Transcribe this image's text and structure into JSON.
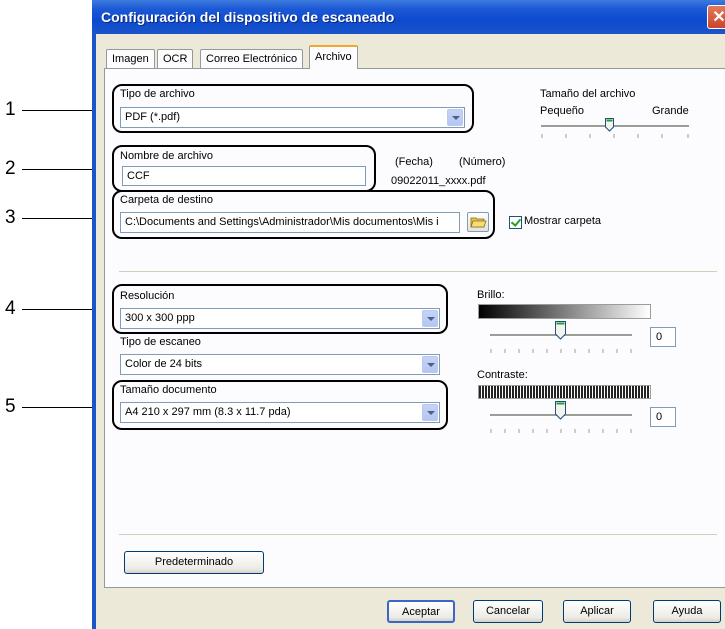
{
  "window": {
    "title": "Configuración del dispositivo de escaneado",
    "close_symbol": "✕"
  },
  "tabs": [
    {
      "label": "Imagen"
    },
    {
      "label": "OCR"
    },
    {
      "label": "Correo Electrónico"
    },
    {
      "label": "Archivo",
      "active": true
    }
  ],
  "callouts": [
    "1",
    "2",
    "3",
    "4",
    "5"
  ],
  "file_type": {
    "label": "Tipo de archivo",
    "value": "PDF (*.pdf)"
  },
  "file_size": {
    "label": "Tamaño del archivo",
    "small": "Pequeño",
    "large": "Grande",
    "level_fraction": 0.53
  },
  "file_name": {
    "label": "Nombre de archivo",
    "value": "CCF",
    "date_hint": "(Fecha)",
    "number_hint": "(Número)",
    "example": "09022011_xxxx.pdf"
  },
  "destination": {
    "label": "Carpeta de destino",
    "value": "C:\\Documents and Settings\\Administrador\\Mis documentos\\Mis i",
    "show_folder_label": "Mostrar carpeta",
    "show_folder_checked": true
  },
  "resolution": {
    "label": "Resolución",
    "value": "300 x 300 ppp"
  },
  "scan_type": {
    "label": "Tipo de escaneo",
    "value": "Color de 24 bits"
  },
  "document_size": {
    "label": "Tamaño documento",
    "value": "A4 210 x 297 mm (8.3 x 11.7 pda)"
  },
  "brightness": {
    "label": "Brillo:",
    "value": "0",
    "level_fraction": 0.5
  },
  "contrast": {
    "label": "Contraste:",
    "value": "0",
    "level_fraction": 0.5
  },
  "buttons": {
    "default": "Predeterminado",
    "ok": "Aceptar",
    "cancel": "Cancelar",
    "apply": "Aplicar",
    "help": "Ayuda"
  },
  "colors": {
    "title_bar": "#1d5ad6",
    "dialog_bg": "#ece9d8",
    "active_tab_accent": "#f4a72d",
    "field_border": "#7f9db9"
  }
}
